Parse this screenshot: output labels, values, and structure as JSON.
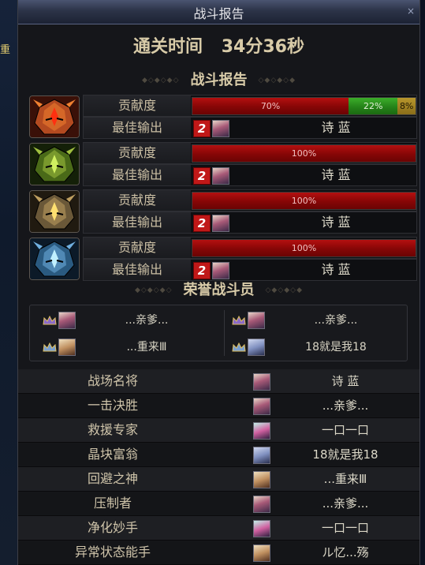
{
  "window": {
    "title": "战斗报告",
    "close_glyph": "×"
  },
  "background": {
    "left_label": "重"
  },
  "clear_time": {
    "label": "通关时间",
    "value": "34分36秒"
  },
  "battle_report": {
    "header": "战斗报告",
    "contribution_label": "贡献度",
    "best_output_label": "最佳输出",
    "bosses": [
      {
        "icon": "fire-boss-icon",
        "segments": [
          {
            "pct_text": "70%",
            "value": 70,
            "color": "red"
          },
          {
            "pct_text": "22%",
            "value": 22,
            "color": "green"
          },
          {
            "pct_text": "8%",
            "value": 8,
            "color": "gold"
          }
        ],
        "best_rank": "2",
        "best_player": "诗 蓝"
      },
      {
        "icon": "nature-boss-icon",
        "segments": [
          {
            "pct_text": "100%",
            "value": 100,
            "color": "red"
          }
        ],
        "best_rank": "2",
        "best_player": "诗 蓝"
      },
      {
        "icon": "dark-boss-icon",
        "segments": [
          {
            "pct_text": "100%",
            "value": 100,
            "color": "red"
          }
        ],
        "best_rank": "2",
        "best_player": "诗 蓝"
      },
      {
        "icon": "ice-boss-icon",
        "segments": [
          {
            "pct_text": "100%",
            "value": 100,
            "color": "red"
          }
        ],
        "best_rank": "2",
        "best_player": "诗 蓝"
      }
    ]
  },
  "honor": {
    "header": "荣誉战斗员",
    "players": [
      "...亲爹...",
      "...亲爹...",
      "...重来Ⅲ",
      "18就是我18"
    ]
  },
  "awards": [
    {
      "title": "战场名将",
      "player": "诗 蓝"
    },
    {
      "title": "一击决胜",
      "player": "...亲爹..."
    },
    {
      "title": "救援专家",
      "player": "一口一口"
    },
    {
      "title": "晶块富翁",
      "player": "18就是我18"
    },
    {
      "title": "回避之神",
      "player": "...重来Ⅲ"
    },
    {
      "title": "压制者",
      "player": "...亲爹..."
    },
    {
      "title": "净化妙手",
      "player": "一口一口"
    },
    {
      "title": "异常状态能手",
      "player": "ル忆...殇"
    }
  ],
  "colors": {
    "bar_red": "#a00c0c",
    "bar_green": "#2f9a22",
    "bar_gold": "#a8862a",
    "rank_badge": "#c01818",
    "header_text": "#d8cba8"
  }
}
